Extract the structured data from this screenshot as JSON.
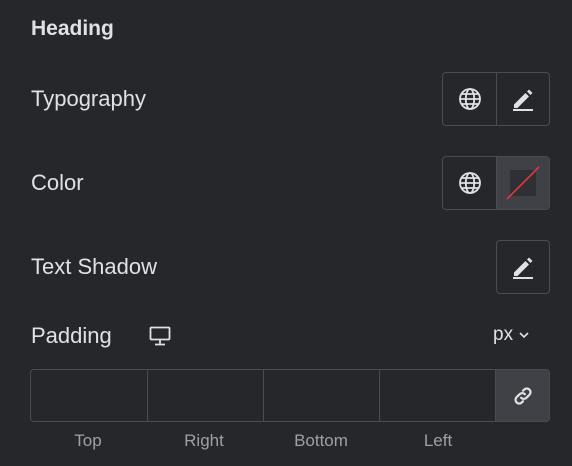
{
  "section": {
    "title": "Heading"
  },
  "typography": {
    "label": "Typography",
    "icons": [
      "globe-icon",
      "pencil-icon"
    ]
  },
  "color": {
    "label": "Color",
    "icons": [
      "globe-icon",
      "no-color-swatch"
    ],
    "none_line_color": "#e2373f"
  },
  "text_shadow": {
    "label": "Text Shadow",
    "icons": [
      "pencil-icon"
    ]
  },
  "padding": {
    "label": "Padding",
    "device_icon": "desktop-icon",
    "unit": "px",
    "fields": [
      {
        "label": "Top",
        "value": ""
      },
      {
        "label": "Right",
        "value": ""
      },
      {
        "label": "Bottom",
        "value": ""
      },
      {
        "label": "Left",
        "value": ""
      }
    ],
    "link_icon": "link-icon"
  },
  "colors": {
    "background": "#26272b",
    "border": "#4a4c52",
    "active": "#3f4147",
    "text": "#e0e1e4",
    "muted": "#9ea0a6"
  }
}
